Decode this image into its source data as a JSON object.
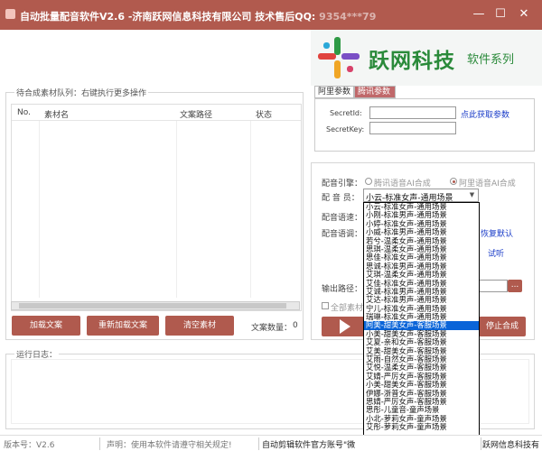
{
  "window": {
    "title": "自动批量配音软件V2.6 -济南跃网信息科技有限公司 技术售后QQ:",
    "qq_masked": "9354***79",
    "minimize": "—",
    "maximize": "☐",
    "close": "✕"
  },
  "banner": {
    "logo_text": "跃网科技",
    "logo_sub": "软件系列"
  },
  "queue": {
    "group_title": "待合成素材队列：右键执行更多操作",
    "columns": [
      "No.",
      "素材名",
      "文案路径",
      "状态"
    ]
  },
  "buttons": {
    "load": "加载文案",
    "reload": "重新加载文案",
    "clear": "清空素材",
    "stop": "停止合成"
  },
  "material_count": {
    "label": "文案数量：",
    "value": "0"
  },
  "tabs": [
    {
      "label": "阿里参数",
      "active": false
    },
    {
      "label": "腾讯参数",
      "active": true
    }
  ],
  "tencent": {
    "secret_id_label": "SecretId:",
    "secret_key_label": "SecretKey:",
    "secret_id_value": "",
    "secret_key_value": "",
    "get_params_link": "点此获取参数"
  },
  "engine": {
    "label": "配音引擎：",
    "options": [
      {
        "label": "腾讯语音AI合成",
        "selected": false
      },
      {
        "label": "阿里语音AI合成",
        "selected": true
      }
    ]
  },
  "voice": {
    "label": "配 音 员：",
    "selected": "小云-标准女声-通用场景",
    "options": [
      "小云-标准女声-通用场景",
      "小刚-标准男声-通用场景",
      "小婷-标准女声-通用场景",
      "小威-标准男声-通用场景",
      "若兮-温柔女声-通用场景",
      "思琪-温柔女声-通用场景",
      "思佳-标准女声-通用场景",
      "思诚-标准男声-通用场景",
      "艾琪-温柔女声-通用场景",
      "艾佳-标准女声-通用场景",
      "艾诚-标准男声-通用场景",
      "艾达-标准男声-通用场景",
      "宁儿-标准女声-通用场景",
      "瑞琳-标准女声-通用场景",
      "阿美-甜美女声-客服场景",
      "小美-甜美女声-客服场景",
      "艾夏-亲和女声-客服场景",
      "艾美-甜美女声-客服场景",
      "艾雨-自然女声-客服场景",
      "艾悦-温柔女声-客服场景",
      "艾婧-严厉女声-客服场景",
      "小美-甜美女声-客服场景",
      "伊娜-浙普女声-客服场景",
      "思婧-严厉女声-客服场景",
      "思彤-儿童音-童声场景",
      "小北-萝莉女声-童声场景",
      "艾彤-萝莉女声-童声场景"
    ],
    "highlighted_index": 14
  },
  "speed": {
    "label": "配音语速："
  },
  "tone": {
    "label": "配音语调：",
    "default_suffix": "恢复默认",
    "listen": "试听"
  },
  "output": {
    "label": "输出路径：",
    "browse": "..."
  },
  "all_material": {
    "label": "全部素材"
  },
  "log": {
    "group_title": "运行日志："
  },
  "status": {
    "version": "版本号：V2.6",
    "notice": "声明：使用本软件请遵守相关规定!",
    "account": "自动剪辑软件官方账号\"微",
    "company": "跃网信息科技有"
  },
  "colors": {
    "accent": "#b05a4e",
    "link": "#1a3cc8",
    "highlight": "#0a64d8"
  }
}
